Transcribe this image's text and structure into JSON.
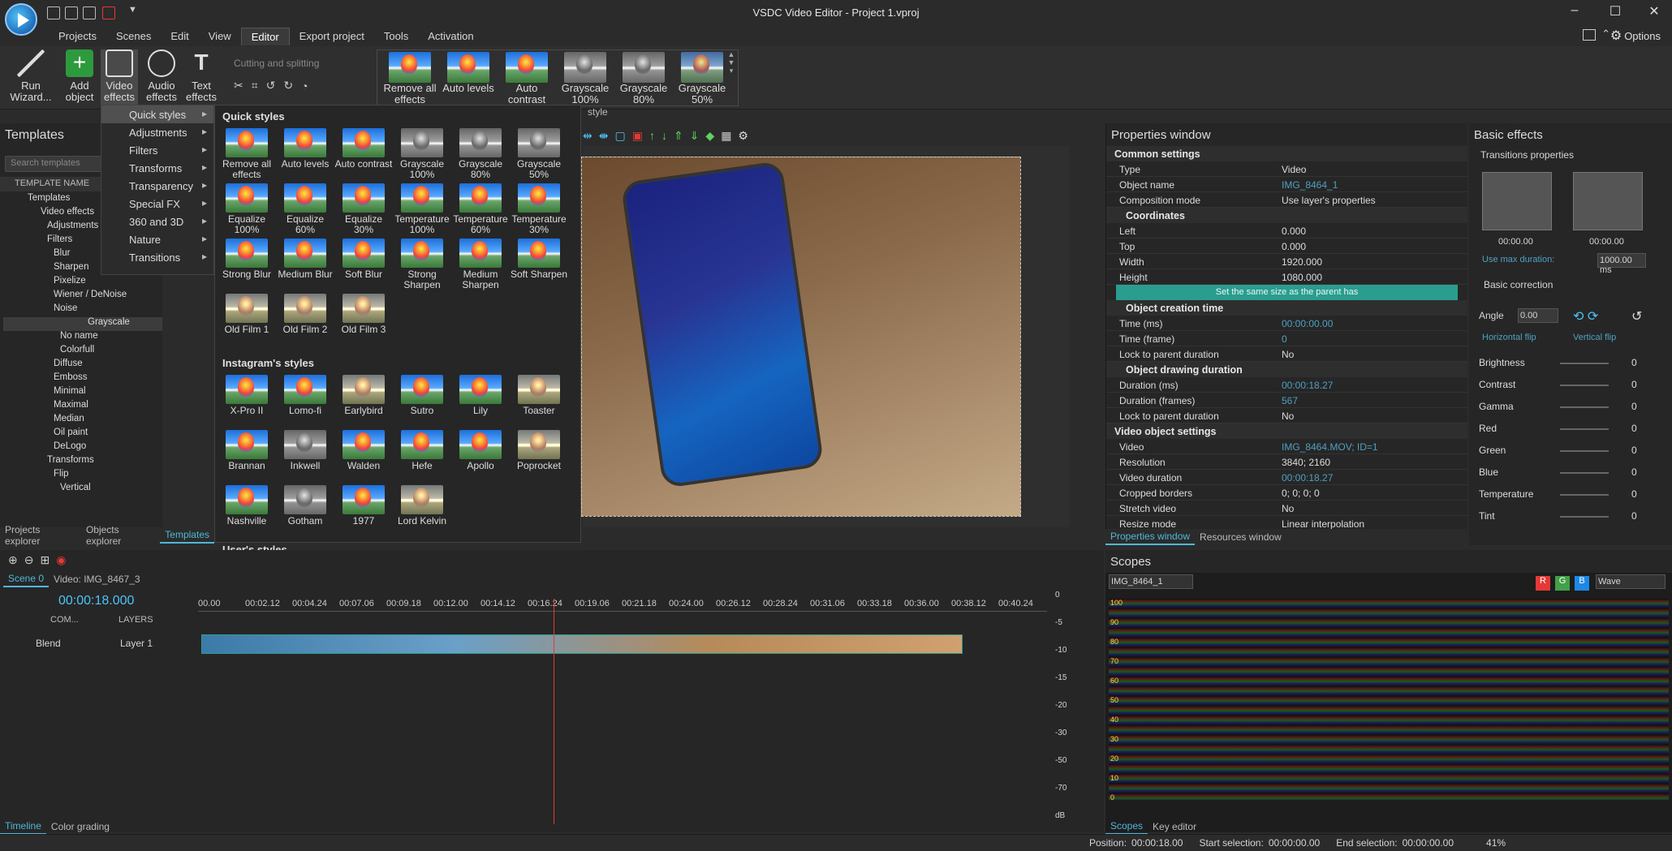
{
  "app": {
    "title": "VSDC Video Editor - Project 1.vproj",
    "options": "Options"
  },
  "menu": [
    "Projects",
    "Scenes",
    "Edit",
    "View",
    "Editor",
    "Export project",
    "Tools",
    "Activation"
  ],
  "ribbon": {
    "run_wizard": "Run Wizard...",
    "add_object": "Add object",
    "video_effects": "Video effects",
    "audio_effects": "Audio effects",
    "text_effects": "Text effects",
    "cutting": "Cutting and splitting",
    "quick": [
      "Remove all effects",
      "Auto levels",
      "Auto contrast",
      "Grayscale 100%",
      "Grayscale 80%",
      "Grayscale 50%"
    ],
    "style_caption": "style"
  },
  "dropdown": [
    "Quick styles",
    "Adjustments",
    "Filters",
    "Transforms",
    "Transparency",
    "Special FX",
    "360 and 3D",
    "Nature",
    "Transitions"
  ],
  "styles": {
    "quick_title": "Quick styles",
    "quick": [
      "Remove all effects",
      "Auto levels",
      "Auto contrast",
      "Grayscale 100%",
      "Grayscale 80%",
      "Grayscale 50%",
      "Equalize 100%",
      "Equalize 60%",
      "Equalize 30%",
      "Temperature 100%",
      "Temperature 60%",
      "Temperature 30%",
      "Strong Blur",
      "Medium Blur",
      "Soft Blur",
      "Strong Sharpen",
      "Medium Sharpen",
      "Soft Sharpen",
      "Old Film 1",
      "Old Film 2",
      "Old Film 3"
    ],
    "insta_title": "Instagram's styles",
    "insta": [
      "X-Pro II",
      "Lomo-fi",
      "Earlybird",
      "Sutro",
      "Lily",
      "Toaster",
      "Brannan",
      "Inkwell",
      "Walden",
      "Hefe",
      "Apollo",
      "Poprocket",
      "Nashville",
      "Gotham",
      "1977",
      "Lord Kelvin"
    ],
    "user_title": "User's styles"
  },
  "templates": {
    "title": "Templates",
    "search": "Search templates",
    "col": "TEMPLATE NAME",
    "tree": [
      "Templates",
      "Video effects",
      "Adjustments",
      "Filters",
      "Blur",
      "Sharpen",
      "Pixelize",
      "Wiener / DeNoise",
      "Noise",
      "Grayscale",
      "No name",
      "Colorfull",
      "Diffuse",
      "Emboss",
      "Minimal",
      "Maximal",
      "Median",
      "Oil paint",
      "DeLogo",
      "Transforms",
      "Flip",
      "Vertical"
    ],
    "tabs": [
      "Projects explorer",
      "Objects explorer",
      "Templates"
    ]
  },
  "props": {
    "title": "Properties window",
    "common": "Common settings",
    "rows1": [
      [
        "Type",
        "Video"
      ],
      [
        "Object name",
        "IMG_8464_1"
      ],
      [
        "Composition mode",
        "Use layer's properties"
      ]
    ],
    "coords": "Coordinates",
    "rows2": [
      [
        "Left",
        "0.000"
      ],
      [
        "Top",
        "0.000"
      ],
      [
        "Width",
        "1920.000"
      ],
      [
        "Height",
        "1080.000"
      ]
    ],
    "same_size": "Set the same size as the parent has",
    "creation": "Object creation time",
    "rows3": [
      [
        "Time (ms)",
        "00:00:00.00"
      ],
      [
        "Time (frame)",
        "0"
      ],
      [
        "Lock to parent duration",
        "No"
      ]
    ],
    "drawing": "Object drawing duration",
    "rows4": [
      [
        "Duration (ms)",
        "00:00:18.27"
      ],
      [
        "Duration (frames)",
        "567"
      ],
      [
        "Lock to parent duration",
        "No"
      ]
    ],
    "video_settings": "Video object settings",
    "rows5": [
      [
        "Video",
        "IMG_8464.MOV; ID=1"
      ],
      [
        "Resolution",
        "3840; 2160"
      ],
      [
        "Video duration",
        "00:00:18.27"
      ],
      [
        "Cropped borders",
        "0; 0; 0; 0"
      ],
      [
        "Stretch video",
        "No"
      ],
      [
        "Resize mode",
        "Linear interpolation"
      ]
    ],
    "tabs": [
      "Properties window",
      "Resources window"
    ]
  },
  "basic": {
    "title": "Basic effects",
    "transitions": "Transitions properties",
    "t1": "00:00.00",
    "t2": "00:00.00",
    "use_max": "Use max duration:",
    "max_val": "1000.00 ms",
    "correction": "Basic correction",
    "angle": "Angle",
    "angle_val": "0.00",
    "hflip": "Horizontal flip",
    "vflip": "Vertical flip",
    "sliders": [
      [
        "Brightness",
        "0"
      ],
      [
        "Contrast",
        "0"
      ],
      [
        "Gamma",
        "0"
      ],
      [
        "Red",
        "0"
      ],
      [
        "Green",
        "0"
      ],
      [
        "Blue",
        "0"
      ],
      [
        "Temperature",
        "0"
      ],
      [
        "Tint",
        "0"
      ]
    ]
  },
  "timeline": {
    "scene": "Scene 0",
    "video": "Video: IMG_8467_3",
    "time": "00:00:18.000",
    "com": "COM...",
    "layers": "LAYERS",
    "blend": "Blend",
    "layer1": "Layer 1",
    "ticks": [
      "00.00",
      "00:02.12",
      "00:04.24",
      "00:07.06",
      "00:09.18",
      "00:12.00",
      "00:14.12",
      "00:16.24",
      "00:19.06",
      "00:21.18",
      "00:24.00",
      "00:26.12",
      "00:28.24",
      "00:31.06",
      "00:33.18",
      "00:36.00",
      "00:38.12",
      "00:40.24"
    ],
    "db": [
      "0",
      "-5",
      "-10",
      "-15",
      "-20",
      "-30",
      "-50",
      "-70",
      "dB"
    ],
    "tabs": [
      "Timeline",
      "Color grading"
    ]
  },
  "scopes": {
    "title": "Scopes",
    "source": "IMG_8464_1",
    "mode": "Wave",
    "r": "R",
    "g": "G",
    "b": "B",
    "scale": [
      "100",
      "90",
      "80",
      "70",
      "60",
      "50",
      "40",
      "30",
      "20",
      "10",
      "0"
    ],
    "tabs": [
      "Scopes",
      "Key editor"
    ]
  },
  "status": {
    "position_lbl": "Position:",
    "position": "00:00:18.00",
    "start_lbl": "Start selection:",
    "start": "00:00:00.00",
    "end_lbl": "End selection:",
    "end": "00:00:00.00",
    "zoom": "41%"
  }
}
